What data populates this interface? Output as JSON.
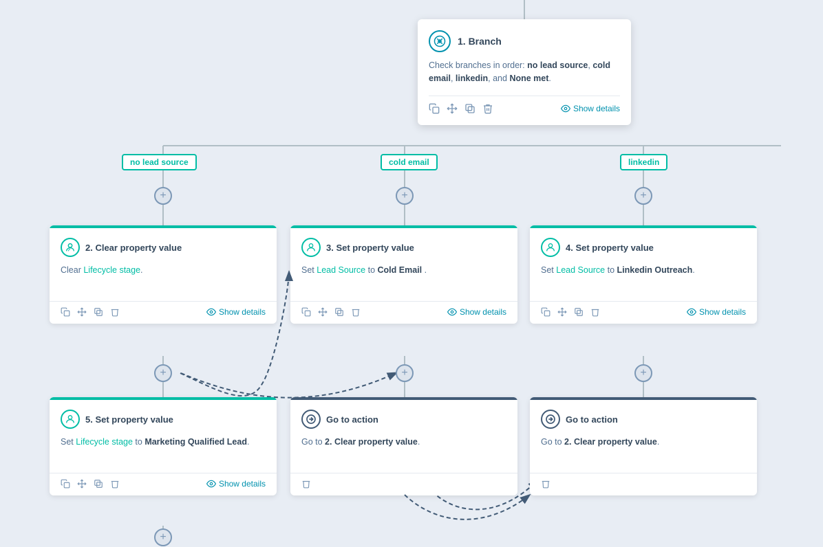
{
  "branch": {
    "title": "1. Branch",
    "description_prefix": "Check branches in order: ",
    "bold_parts": [
      "no lead source",
      "cold email",
      "linkedin",
      "None met"
    ],
    "description": "Check branches in order: no lead source, cold email, linkedin, and None met.",
    "footer_icons": [
      "copy",
      "move",
      "clone",
      "delete"
    ],
    "show_details": "Show details"
  },
  "labels": [
    {
      "id": "lbl-1",
      "text": "no lead source"
    },
    {
      "id": "lbl-2",
      "text": "cold email"
    },
    {
      "id": "lbl-3",
      "text": "linkedin"
    }
  ],
  "cards": [
    {
      "id": "card-2",
      "number": "2",
      "title": "2. Clear property value",
      "content_html": "Clear <span class='link-text'>Lifecycle stage</span>.",
      "border": "green",
      "show_details": "Show details"
    },
    {
      "id": "card-3",
      "number": "3",
      "title": "3. Set property value",
      "content_html": "Set <span class='link-text'>Lead Source</span> to <span class='bold-text'>Cold Email</span> .",
      "border": "green",
      "show_details": "Show details"
    },
    {
      "id": "card-4",
      "number": "4",
      "title": "4. Set property value",
      "content_html": "Set <span class='link-text'>Lead Source</span> to <span class='bold-text'>Linkedin Outreach</span>.",
      "border": "green",
      "show_details": "Show details"
    },
    {
      "id": "card-5",
      "number": "5",
      "title": "5. Set property value",
      "content_html": "Set <span class='link-text'>Lifecycle stage</span> to <span class='bold-text'>Marketing Qualified Lead</span>.",
      "border": "green",
      "show_details": "Show details"
    },
    {
      "id": "card-goto-1",
      "title": "Go to action",
      "content_html": "Go to <span class='bold-text'>2. Clear property value</span>.",
      "border": "dark",
      "is_goto": true
    },
    {
      "id": "card-goto-2",
      "title": "Go to action",
      "content_html": "Go to <span class='bold-text'>2. Clear property value</span>.",
      "border": "dark",
      "is_goto": true
    }
  ]
}
